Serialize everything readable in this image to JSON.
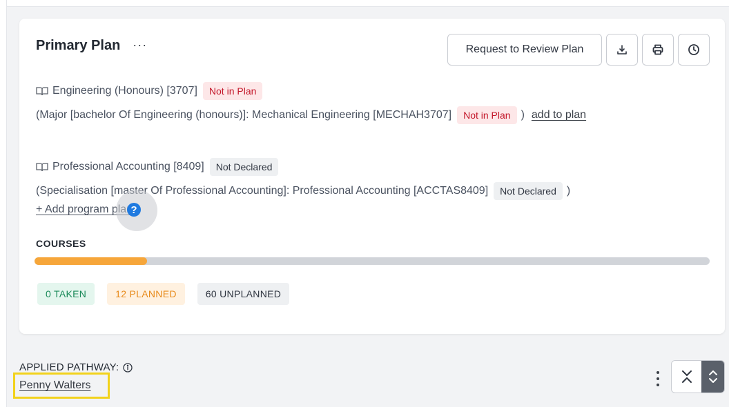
{
  "plan": {
    "title": "Primary Plan",
    "more_label": "···",
    "actions": {
      "review_label": "Request to Review Plan",
      "download_icon": "download-icon",
      "print_icon": "print-icon",
      "history_icon": "clock-icon"
    }
  },
  "programs": [
    {
      "name": "Engineering (Honours) [3707]",
      "status": "Not in Plan",
      "detail": "(Major [bachelor Of Engineering (honours)]: Mechanical Engineering [MECHAH3707]",
      "detail_status": "Not in Plan",
      "detail_close": ")",
      "action": "add to plan"
    },
    {
      "name": "Professional Accounting [8409]",
      "status": "Not Declared",
      "detail": "(Specialisation [master Of Professional Accounting]: Professional Accounting [ACCTAS8409]",
      "detail_status": "Not Declared",
      "detail_close": ")"
    }
  ],
  "add_program_label": "+ Add program plan",
  "help_glyph": "?",
  "courses": {
    "label": "COURSES",
    "progress_planned_fraction": 0.167,
    "taken": "0 TAKEN",
    "planned": "12 PLANNED",
    "unplanned": "60 UNPLANNED"
  },
  "pathway": {
    "label": "APPLIED PATHWAY:",
    "person": "Penny Walters"
  },
  "colors": {
    "not_in_plan_bg": "#fde7e8",
    "not_in_plan_text": "#c3172a",
    "planned": "#f6a63a",
    "taken": "#1b8a5a",
    "help": "#1f7ae0",
    "highlight": "#f2d21b"
  }
}
